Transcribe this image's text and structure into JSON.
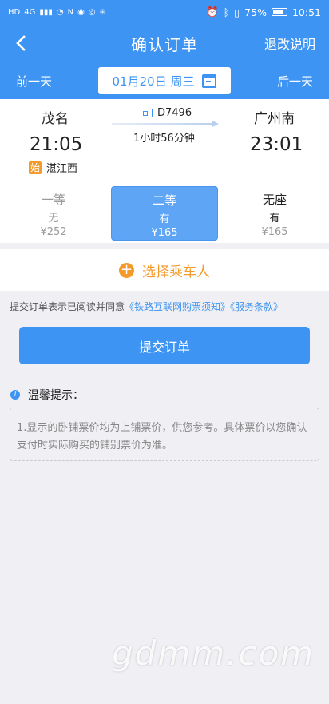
{
  "status": {
    "left_icons": [
      "HD",
      "4G",
      "signal-icon",
      "wifi-icon",
      "nfc-icon",
      "app-icon",
      "app-icon",
      "app-icon"
    ],
    "alarm_icon": "alarm-icon",
    "bluetooth_icon": "bluetooth-icon",
    "battery": "75%",
    "time": "10:51"
  },
  "nav": {
    "title": "确认订单",
    "right": "退改说明"
  },
  "daybar": {
    "prev": "前一天",
    "date": "01月20日 周三",
    "next": "后一天"
  },
  "trip": {
    "from": "茂名",
    "from_time": "21:05",
    "start_tag": "始",
    "start_station": "湛江西",
    "train_no": "D7496",
    "duration": "1小时56分钟",
    "to": "广州南",
    "to_time": "23:01"
  },
  "seats": [
    {
      "name": "一等",
      "availability": "无",
      "price": "¥252",
      "selected": false
    },
    {
      "name": "二等",
      "availability": "有",
      "price": "¥165",
      "selected": true
    },
    {
      "name": "无座",
      "availability": "有",
      "price": "¥165",
      "selected": false
    }
  ],
  "passenger": {
    "label": "选择乘车人"
  },
  "agreement": {
    "prefix": "提交订单表示已阅读并同意",
    "link1": "《铁路互联网购票须知》",
    "link2": "《服务条款》"
  },
  "submit": {
    "label": "提交订单"
  },
  "tips": {
    "title": "温馨提示：",
    "content": "1.显示的卧铺票价均为上铺票价，供您参考。具体票价以您确认支付时实际购买的铺别票价为准。"
  },
  "watermark": "gdmm.com",
  "colors": {
    "primary": "#3e94f2",
    "accent": "#f39a2b"
  }
}
